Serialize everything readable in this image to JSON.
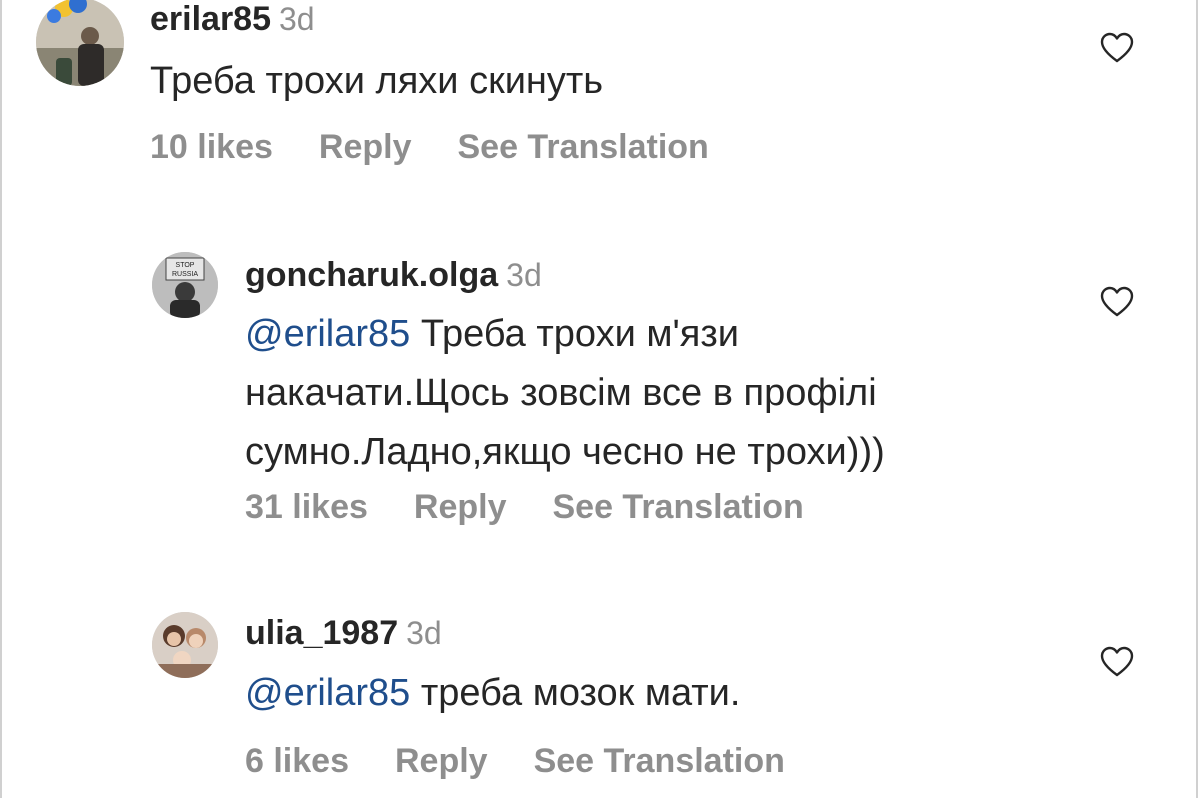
{
  "comments": [
    {
      "username": "erilar85",
      "time": "3d",
      "mention": "",
      "text": "Треба трохи ляхи скинуть",
      "lines": [
        "Треба трохи ляхи скинуть"
      ],
      "likes": "10 likes",
      "reply": "Reply",
      "translate": "See Translation",
      "avatar_icon": "profile-photo-balloons"
    },
    {
      "username": "goncharuk.olga",
      "time": "3d",
      "mention": "@erilar85",
      "lines": [
        "Треба трохи м'язи",
        "накачати.Щось зовсім все в профілі",
        "сумно.Ладно,якщо чесно не трохи)))"
      ],
      "likes": "31 likes",
      "reply": "Reply",
      "translate": "See Translation",
      "avatar_icon": "profile-photo-stop-russia-sign",
      "avatar_sign": "STOP RUSSIA"
    },
    {
      "username": "ulia_1987",
      "time": "3d",
      "mention": "@erilar85",
      "lines": [
        "треба мозок мати."
      ],
      "likes": "6 likes",
      "reply": "Reply",
      "translate": "See Translation",
      "avatar_icon": "profile-photo-family"
    }
  ],
  "icons": {
    "like": "heart-outline-icon"
  },
  "colors": {
    "text": "#262626",
    "muted": "#8e8e8e",
    "mention": "#1f4e8c"
  }
}
